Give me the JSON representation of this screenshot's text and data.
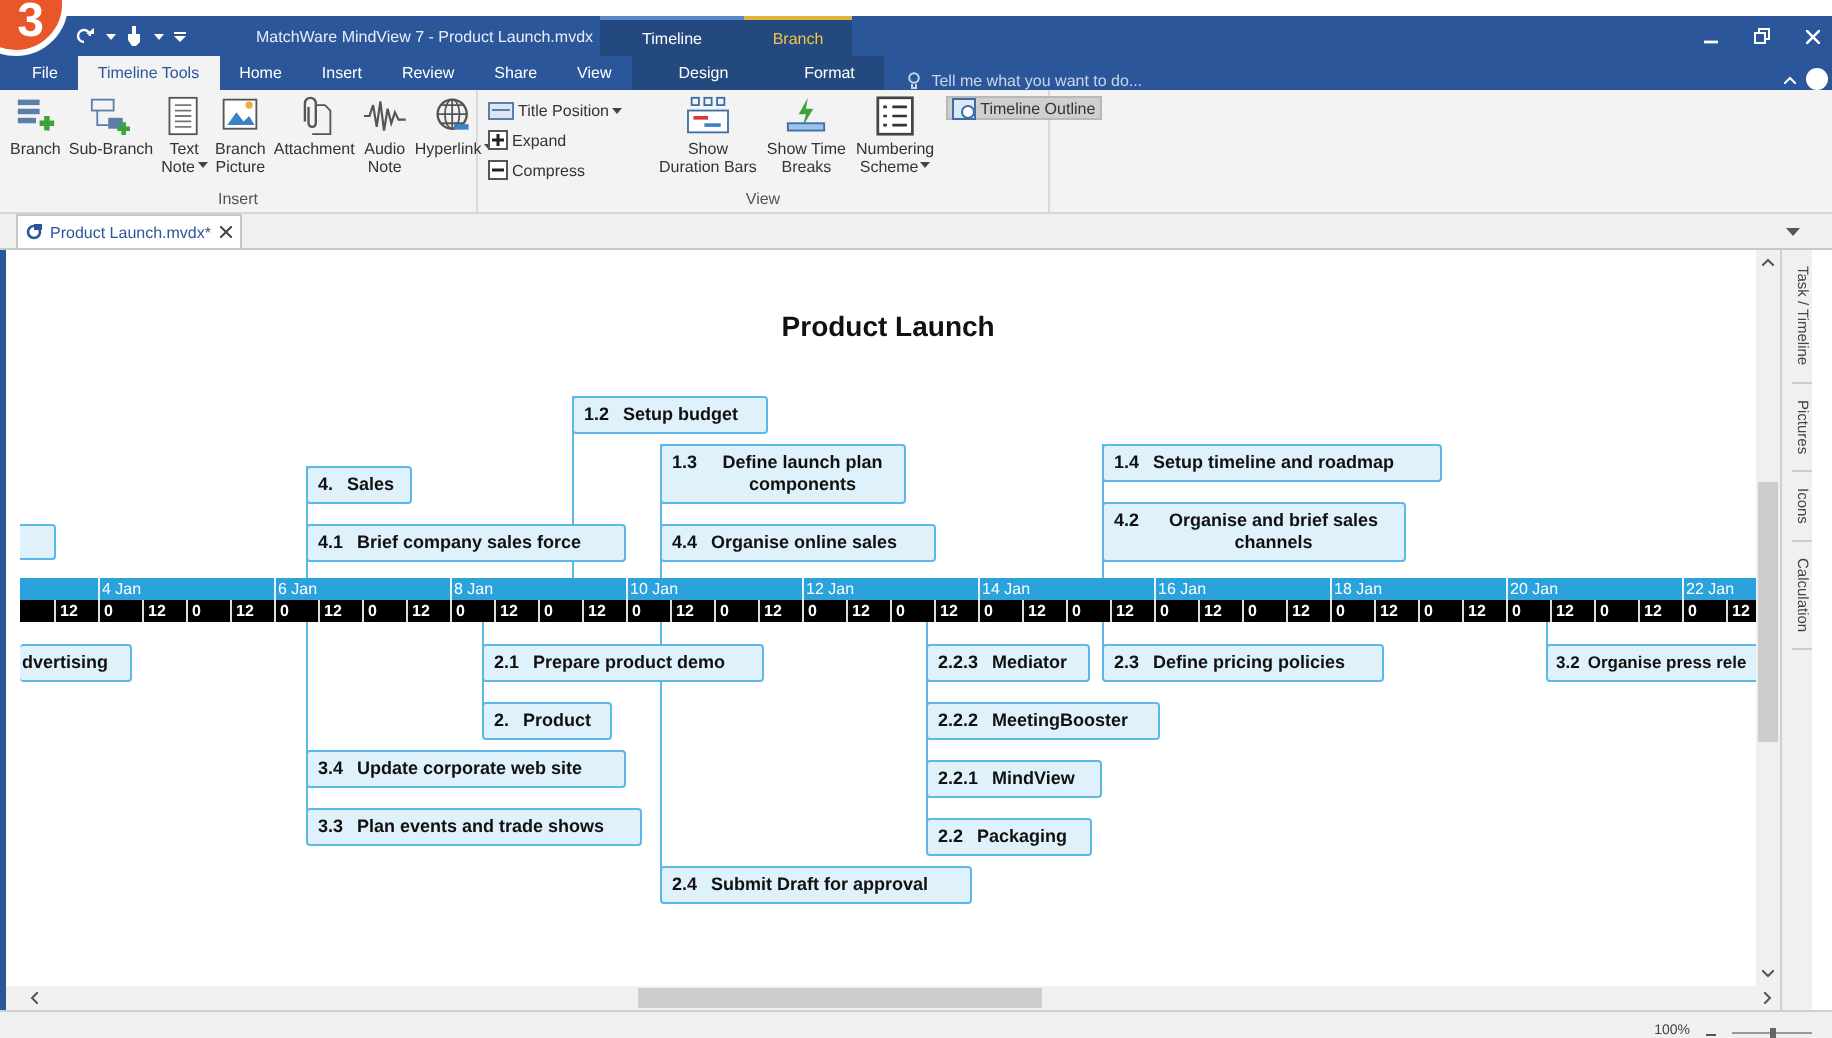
{
  "step_badge": "3",
  "window": {
    "title": "MatchWare MindView 7 - Product Launch.mvdx",
    "context_groups": [
      {
        "label": "Timeline"
      },
      {
        "label": "Branch"
      }
    ]
  },
  "tabs": [
    {
      "label": "File",
      "selected": false
    },
    {
      "label": "Timeline Tools",
      "selected": true
    },
    {
      "label": "Home",
      "selected": false
    },
    {
      "label": "Insert",
      "selected": false
    },
    {
      "label": "Review",
      "selected": false
    },
    {
      "label": "Share",
      "selected": false
    },
    {
      "label": "View",
      "selected": false
    },
    {
      "label": "Design",
      "selected": false
    },
    {
      "label": "Format",
      "selected": false
    }
  ],
  "tell_me": {
    "placeholder": "Tell me what you want to do..."
  },
  "ribbon": {
    "groups": [
      {
        "label": "Insert",
        "items": [
          {
            "kind": "large",
            "lines": [
              "Branch"
            ],
            "dropdown": false
          },
          {
            "kind": "large",
            "lines": [
              "Sub-Branch"
            ],
            "dropdown": false
          },
          {
            "kind": "large",
            "lines": [
              "Text",
              "Note"
            ],
            "dropdown": true
          },
          {
            "kind": "large",
            "lines": [
              "Branch",
              "Picture"
            ],
            "dropdown": false
          },
          {
            "kind": "large",
            "lines": [
              "Attachment"
            ],
            "dropdown": false
          },
          {
            "kind": "large",
            "lines": [
              "Audio",
              "Note"
            ],
            "dropdown": false
          },
          {
            "kind": "large",
            "lines": [
              "Hyperlink"
            ],
            "dropdown": true
          }
        ]
      },
      {
        "label": "View",
        "items": [
          {
            "kind": "small",
            "lines": [
              "Title Position"
            ],
            "dropdown": true
          },
          {
            "kind": "small",
            "lines": [
              "Expand"
            ],
            "dropdown": false
          },
          {
            "kind": "small",
            "lines": [
              "Compress"
            ],
            "dropdown": false
          },
          {
            "kind": "large",
            "lines": [
              "Show",
              "Duration Bars"
            ],
            "dropdown": false
          },
          {
            "kind": "large",
            "lines": [
              "Show Time",
              "Breaks"
            ],
            "dropdown": false
          },
          {
            "kind": "large",
            "lines": [
              "Numbering",
              "Scheme"
            ],
            "dropdown": true
          },
          {
            "kind": "toggle",
            "lines": [
              "Timeline Outline"
            ],
            "dropdown": false,
            "on": true
          }
        ]
      }
    ]
  },
  "document_tabs": [
    {
      "label": "Product Launch.mvdx*",
      "selected": true
    }
  ],
  "timeline": {
    "title": "Product Launch",
    "dates": [
      "4 Jan",
      "6 Jan",
      "8 Jan",
      "10 Jan",
      "12 Jan",
      "14 Jan",
      "16 Jan",
      "18 Jan",
      "20 Jan",
      "22 Jan"
    ],
    "hours": [
      "12",
      "0",
      "12",
      "0",
      "12",
      "0",
      "12",
      "0",
      "12",
      "0",
      "12",
      "0",
      "12",
      "0",
      "12",
      "0",
      "12",
      "0",
      "12",
      "0",
      "12",
      "0",
      "12",
      "0",
      "12",
      "0",
      "12",
      "0",
      "12",
      "0",
      "12",
      "0",
      "12",
      "0",
      "12",
      "0",
      "12",
      "0",
      "12"
    ],
    "nodes": [
      {
        "number": "1.2",
        "text": "Setup budget"
      },
      {
        "number": "4.",
        "text": "Sales"
      },
      {
        "number": "1.3",
        "text": "Define launch plan components"
      },
      {
        "number": "1.4",
        "text": "Setup timeline and roadmap"
      },
      {
        "number": "4.1",
        "text": "Brief company sales force"
      },
      {
        "number": "4.4",
        "text": "Organise online sales"
      },
      {
        "number": "4.2",
        "text": "Organise and brief sales channels"
      },
      {
        "text": "dvertising"
      },
      {
        "number": "2.1",
        "text": "Prepare product demo"
      },
      {
        "number": "2.2.3",
        "text": "Mediator"
      },
      {
        "number": "2.3",
        "text": "Define pricing policies"
      },
      {
        "number": "3.2",
        "text": "Organise press rele"
      },
      {
        "number": "2.",
        "text": "Product"
      },
      {
        "number": "2.2.2",
        "text": "MeetingBooster"
      },
      {
        "number": "3.4",
        "text": "Update corporate web site"
      },
      {
        "number": "2.2.1",
        "text": "MindView"
      },
      {
        "number": "3.3",
        "text": "Plan events and trade shows"
      },
      {
        "number": "2.2",
        "text": "Packaging"
      },
      {
        "number": "2.4",
        "text": "Submit Draft for approval"
      }
    ]
  },
  "side_panel": {
    "tabs": [
      {
        "label": "Task / Timeline"
      },
      {
        "label": "Pictures"
      },
      {
        "label": "Icons"
      },
      {
        "label": "Calculation"
      }
    ]
  },
  "status_bar": {
    "zoom": "100%",
    "zoom_slider": {
      "level": 0.5
    }
  }
}
